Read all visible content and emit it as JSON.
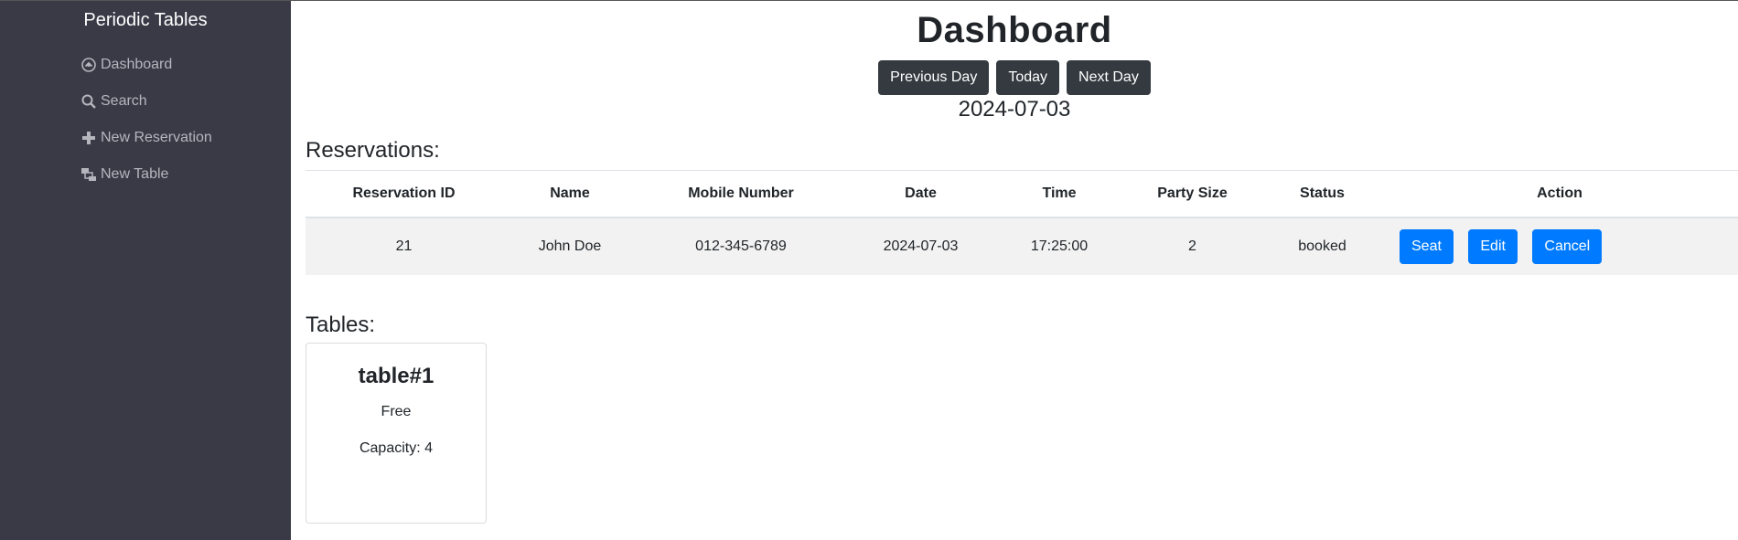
{
  "sidebar": {
    "brand": "Periodic Tables",
    "items": [
      {
        "label": "Dashboard",
        "icon": "dashboard-icon"
      },
      {
        "label": "Search",
        "icon": "search-icon"
      },
      {
        "label": "New Reservation",
        "icon": "plus-icon"
      },
      {
        "label": "New Table",
        "icon": "layers-icon"
      }
    ]
  },
  "header": {
    "title": "Dashboard",
    "previous_label": "Previous Day",
    "today_label": "Today",
    "next_label": "Next Day",
    "date": "2024-07-03"
  },
  "reservations": {
    "title": "Reservations:",
    "columns": [
      "Reservation ID",
      "Name",
      "Mobile Number",
      "Date",
      "Time",
      "Party Size",
      "Status",
      "Action"
    ],
    "rows": [
      {
        "id": "21",
        "name": "John Doe",
        "mobile": "012-345-6789",
        "date": "2024-07-03",
        "time": "17:25:00",
        "party_size": "2",
        "status": "booked",
        "actions": {
          "seat": "Seat",
          "edit": "Edit",
          "cancel": "Cancel"
        }
      }
    ]
  },
  "tables": {
    "title": "Tables:",
    "items": [
      {
        "name": "table#1",
        "status": "Free",
        "capacity": "Capacity: 4"
      }
    ]
  },
  "colors": {
    "sidebar_bg": "#3a3a47",
    "primary": "#007bff",
    "dark_button": "#343a40"
  }
}
